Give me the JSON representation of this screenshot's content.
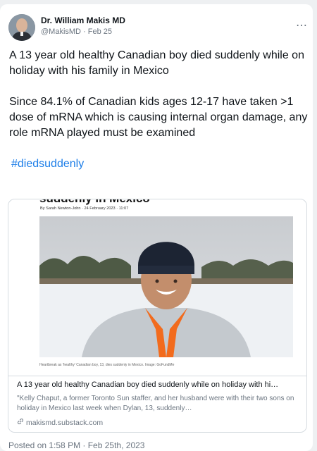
{
  "author": {
    "name": "Dr. William Makis MD",
    "handle": "@MakisMD",
    "date": "Feb 25"
  },
  "more_icon": "⋯",
  "tweet": {
    "paragraph1": "A 13 year old healthy Canadian boy died suddenly while on holiday with his family in Mexico",
    "paragraph2": "Since 84.1% of Canadian kids ages 12-17 have taken >1 dose of mRNA which is causing internal organ damage, any role mRNA played must be examined",
    "hashtag": "#diedsuddenly"
  },
  "link_card": {
    "article_heading_partial": "suddenly in Mexico",
    "byline": "By Sarah Newton-John · 24 February 2023 · 11:07",
    "caption": "Heartbreak as 'healthy' Canadian boy, 13, dies suddenly in Mexico. Image: GoFundMe",
    "title": "A 13 year old healthy Canadian boy died suddenly while on holiday with hi…",
    "description": "\"Kelly Chaput, a former Toronto Sun staffer, and her husband were with their two sons on holiday in Mexico last week when Dylan, 13, suddenly…",
    "domain": "makismd.substack.com",
    "domain_icon": "link-icon"
  },
  "posted": "Posted on 1:58 PM · Feb 25th, 2023"
}
